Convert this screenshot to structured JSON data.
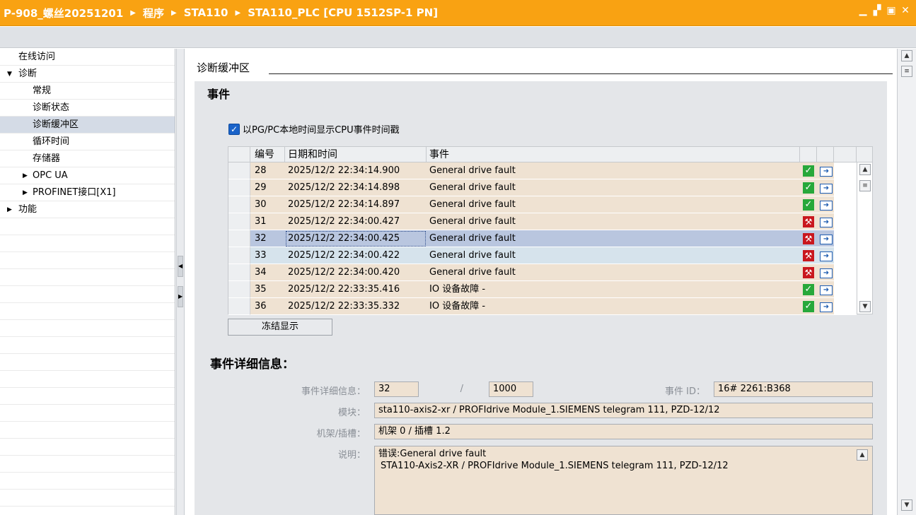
{
  "titlebar": {
    "crumbs": [
      "P-908_螺丝20251201",
      "程序",
      "STA110",
      "STA110_PLC [CPU 1512SP-1 PN]"
    ]
  },
  "sidebar": {
    "items": [
      {
        "label": "在线访问",
        "level": 0,
        "arrow": ""
      },
      {
        "label": "诊断",
        "level": 0,
        "arrow": "▼"
      },
      {
        "label": "常规",
        "level": 1,
        "arrow": ""
      },
      {
        "label": "诊断状态",
        "level": 1,
        "arrow": ""
      },
      {
        "label": "诊断缓冲区",
        "level": 1,
        "arrow": "",
        "selected": true
      },
      {
        "label": "循环时间",
        "level": 1,
        "arrow": ""
      },
      {
        "label": "存储器",
        "level": 1,
        "arrow": ""
      },
      {
        "label": "OPC UA",
        "level": 1,
        "arrow": "▶"
      },
      {
        "label": "PROFINET接口[X1]",
        "level": 1,
        "arrow": "▶"
      },
      {
        "label": "功能",
        "level": 0,
        "arrow": "▶"
      }
    ]
  },
  "content": {
    "section_title": "诊断缓冲区",
    "events_heading": "事件",
    "checkbox_label": "以PG/PC本地时间显示CPU事件时间戳",
    "checkbox_checked": true,
    "columns": [
      "编号",
      "日期和时间",
      "事件"
    ],
    "rows": [
      {
        "num": "28",
        "datetime": "2025/12/2 22:34:14.900",
        "event": "General drive fault",
        "status": "ok"
      },
      {
        "num": "29",
        "datetime": "2025/12/2 22:34:14.898",
        "event": "General drive fault",
        "status": "ok"
      },
      {
        "num": "30",
        "datetime": "2025/12/2 22:34:14.897",
        "event": "General drive fault",
        "status": "ok"
      },
      {
        "num": "31",
        "datetime": "2025/12/2 22:34:00.427",
        "event": "General drive fault",
        "status": "error"
      },
      {
        "num": "32",
        "datetime": "2025/12/2 22:34:00.425",
        "event": "General drive fault",
        "status": "error"
      },
      {
        "num": "33",
        "datetime": "2025/12/2 22:34:00.422",
        "event": "General drive fault",
        "status": "error"
      },
      {
        "num": "34",
        "datetime": "2025/12/2 22:34:00.420",
        "event": "General drive fault",
        "status": "error"
      },
      {
        "num": "35",
        "datetime": "2025/12/2 22:33:35.416",
        "event": "IO 设备故障 -",
        "status": "ok"
      },
      {
        "num": "36",
        "datetime": "2025/12/2 22:33:35.332",
        "event": "IO 设备故障 -",
        "status": "ok"
      }
    ],
    "freeze_button": "冻结显示",
    "detail_heading": "事件详细信息：",
    "detail": {
      "info_label": "事件详细信息：",
      "info_value": "32",
      "info_sep": "/",
      "info_total": "1000",
      "event_id_label": "事件 ID：",
      "event_id_value": "16# 2261:B368",
      "module_label": "模块：",
      "module_value": "sta110-axis2-xr / PROFIdrive Module_1.SIEMENS telegram 111, PZD-12/12",
      "rack_label": "机架/插槽：",
      "rack_value": "机架 0 / 插槽 1.2",
      "desc_label": "说明：",
      "desc_line1": "错误:General drive fault",
      "desc_line2": "STA110-Axis2-XR / PROFIdrive Module_1.SIEMENS telegram 111, PZD-12/12"
    }
  },
  "icons": {
    "ok": "green-check-icon",
    "error": "red-wrench-icon",
    "entry": "incoming-event-icon"
  },
  "colors": {
    "titlebar": "#f9a212",
    "row_bg": "#efe2d2",
    "row_selected": "#b9c6df"
  }
}
